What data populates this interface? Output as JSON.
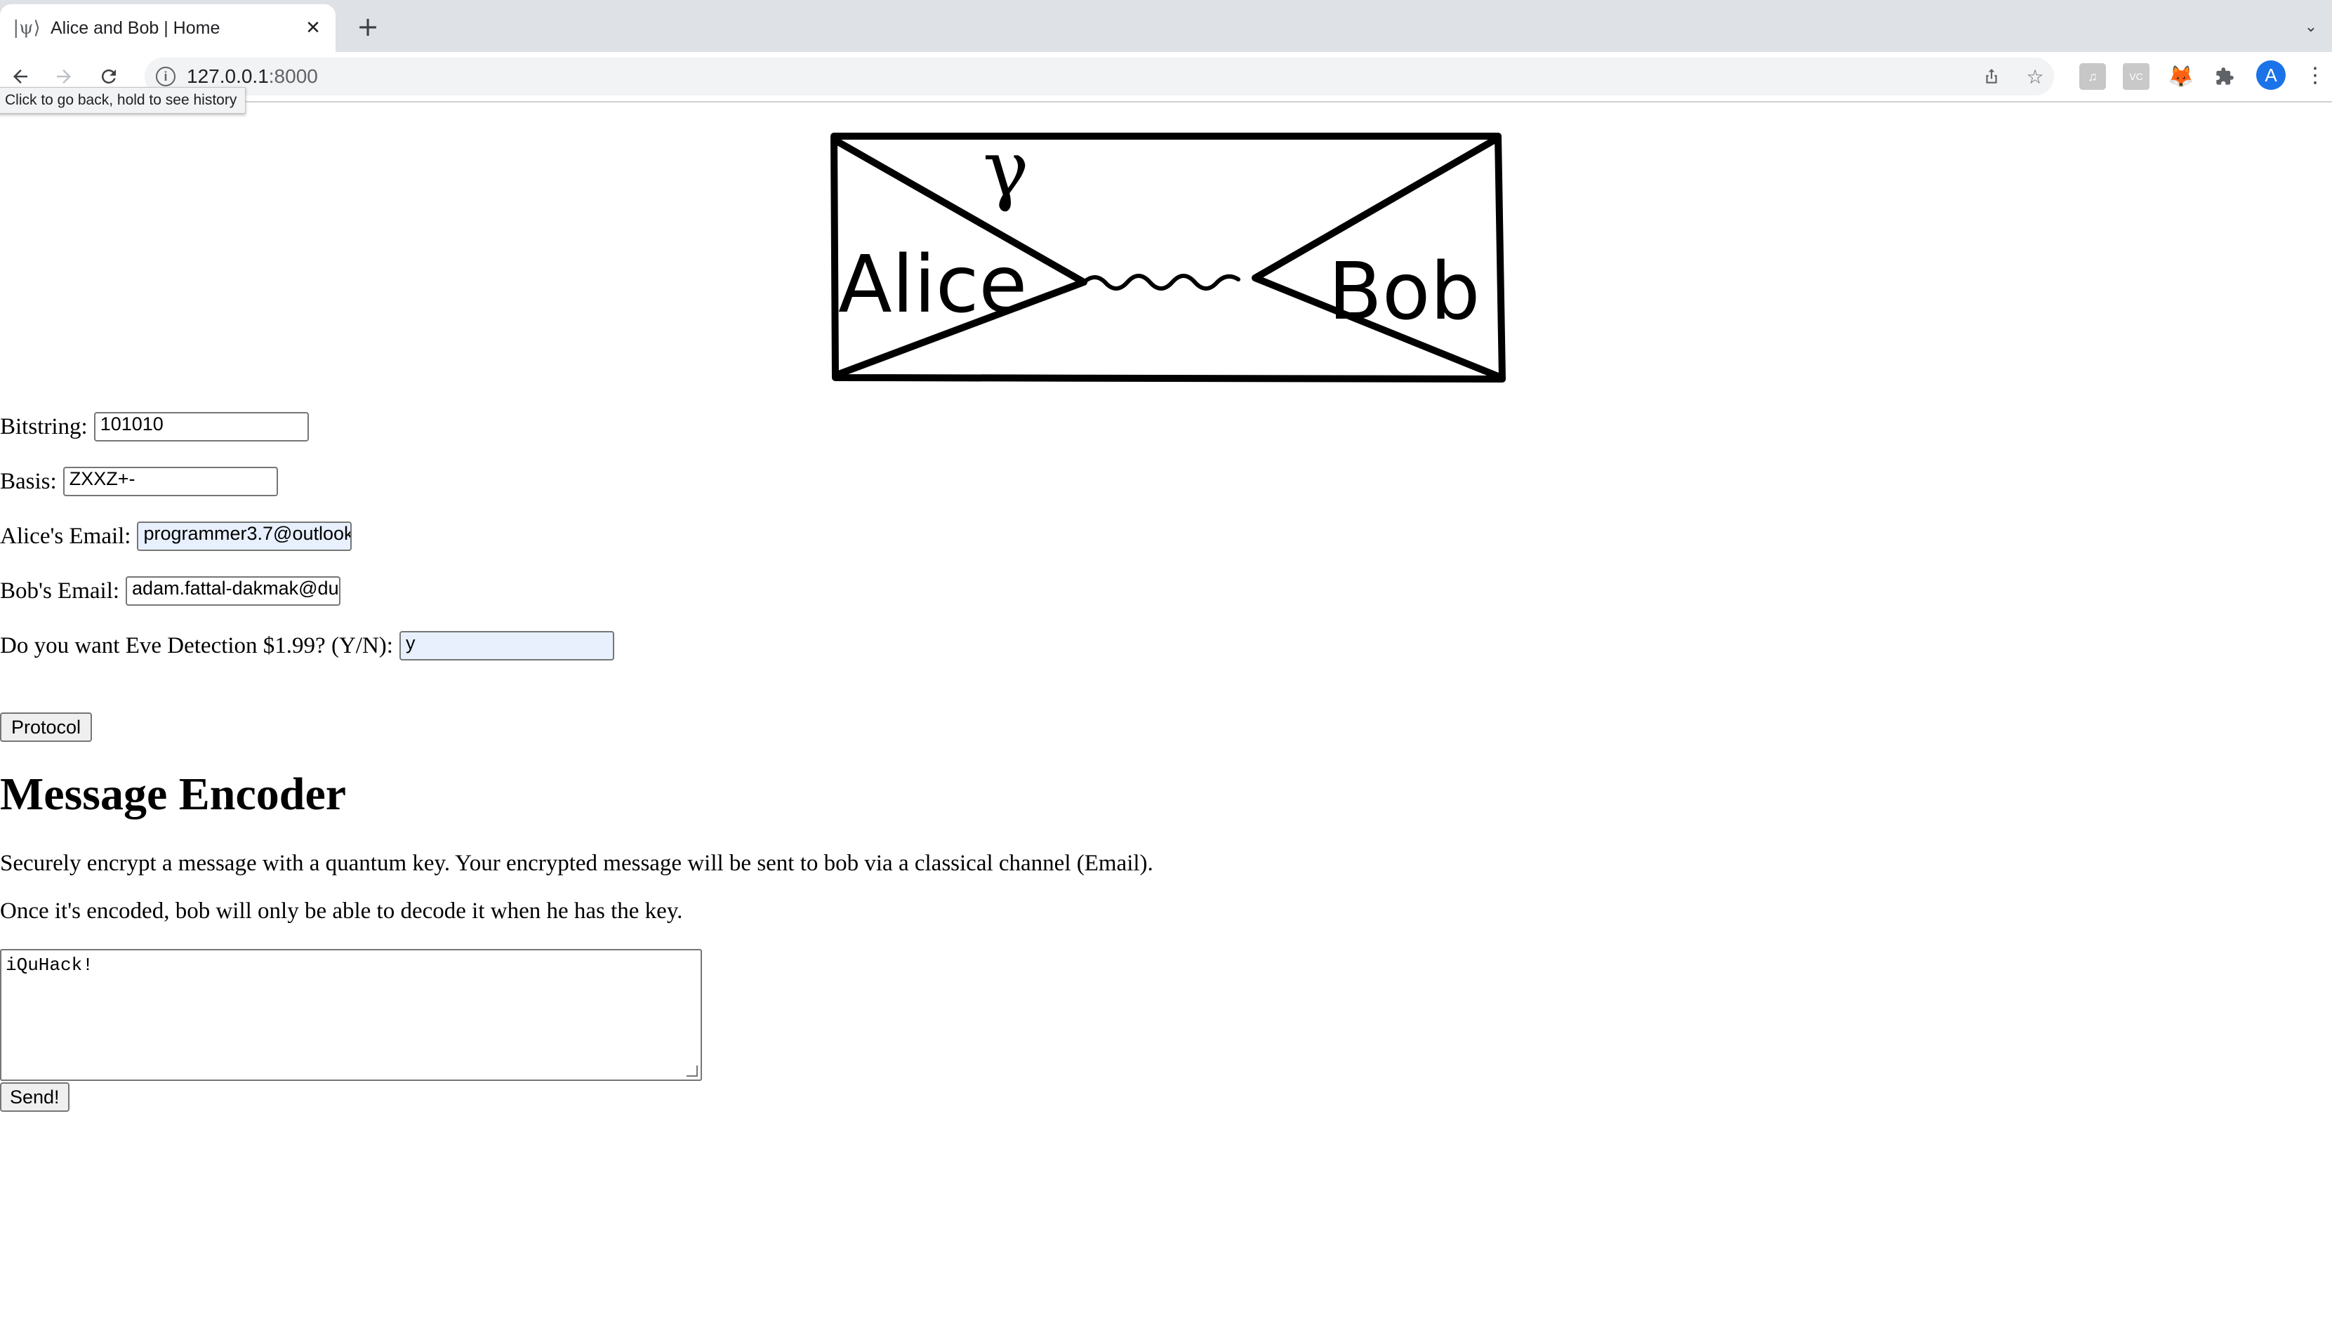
{
  "browser": {
    "tab_favicon": "|ψ⟩",
    "tab_title": "Alice and Bob | Home",
    "url_host": "127.0.0.1",
    "url_port": ":8000",
    "tooltip": "Click to go back, hold to see history",
    "avatar_letter": "A",
    "extensions": {
      "ext1_label": "♫",
      "ext2_label": "VC"
    },
    "icons": {
      "back": "back-arrow-icon",
      "forward": "forward-arrow-icon",
      "reload": "reload-icon",
      "info": "info-icon",
      "share": "share-icon",
      "star": "bookmark-star-icon",
      "metamask": "fox-icon",
      "extensions": "puzzle-icon",
      "menu": "kebab-menu-icon"
    }
  },
  "logo": {
    "left_name": "Alice",
    "right_name": "Bob",
    "photon_symbol": "γ"
  },
  "form": {
    "bitstring_label": "Bitstring:",
    "bitstring_value": "101010",
    "basis_label": "Basis:",
    "basis_value": "ZXXZ+-",
    "alice_email_label": "Alice's Email:",
    "alice_email_value": "programmer3.7@outlook",
    "bob_email_label": "Bob's Email:",
    "bob_email_value": "adam.fattal-dakmak@du",
    "eve_label": "Do you want Eve Detection $1.99? (Y/N):",
    "eve_value": "y",
    "protocol_button": "Protocol"
  },
  "encoder": {
    "heading": "Message Encoder",
    "para1": "Securely encrypt a message with a quantum key. Your encrypted message will be sent to bob via a classical channel (Email).",
    "para2": "Once it's encoded, bob will only be able to decode it when he has the key.",
    "message_value": "iQuHack!",
    "send_button": "Send!"
  }
}
